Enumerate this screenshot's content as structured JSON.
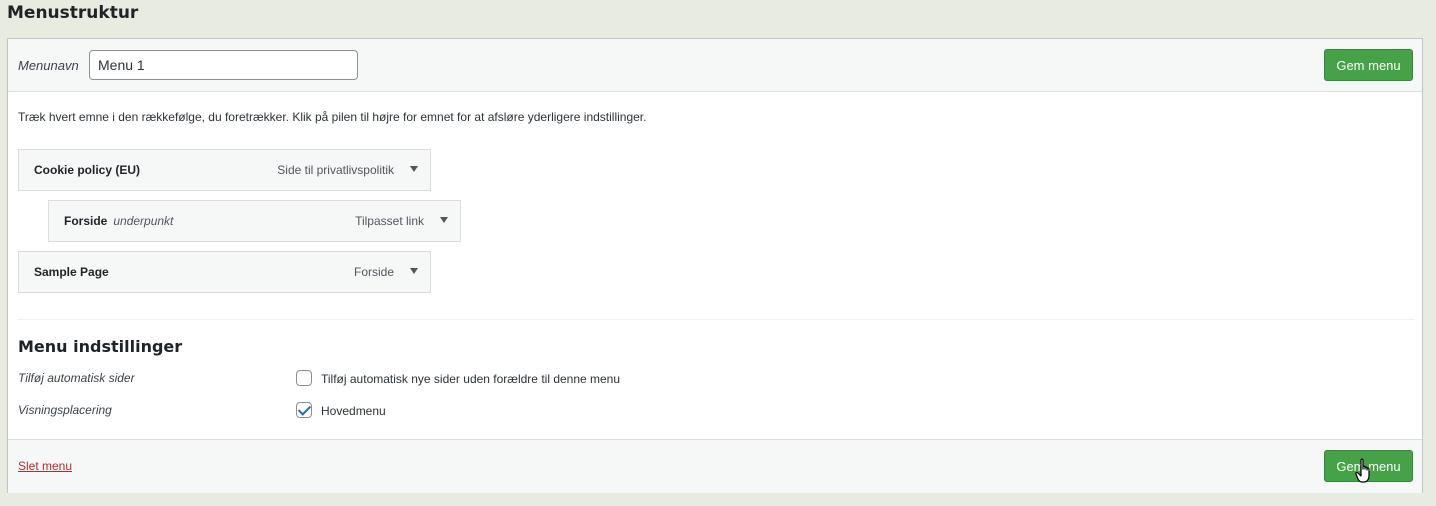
{
  "page": {
    "title": "Menustruktur"
  },
  "header": {
    "menu_name_label": "Menunavn",
    "menu_name_value": "Menu 1",
    "save_label": "Gem menu"
  },
  "instructions": "Træk hvert emne i den rækkefølge, du foretrækker. Klik på pilen til højre for emnet for at afsløre yderligere indstillinger.",
  "menu_items": [
    {
      "title": "Cookie policy (EU)",
      "sub": "",
      "type": "Side til privatlivspolitik"
    },
    {
      "title": "Forside",
      "sub": "underpunkt",
      "type": "Tilpasset link"
    },
    {
      "title": "Sample Page",
      "sub": "",
      "type": "Forside"
    }
  ],
  "settings": {
    "title": "Menu indstillinger",
    "auto_add_label": "Tilføj automatisk sider",
    "auto_add_option": "Tilføj automatisk nye sider uden forældre til denne menu",
    "auto_add_checked": false,
    "location_label": "Visningsplacering",
    "location_option": "Hovedmenu",
    "location_checked": true
  },
  "footer": {
    "delete_label": "Slet menu",
    "save_label": "Gem menu"
  },
  "colors": {
    "background": "#e8ebe0",
    "save_button": "#46a246",
    "delete_link": "#b32d2e",
    "checkbox_check": "#2271b1"
  }
}
